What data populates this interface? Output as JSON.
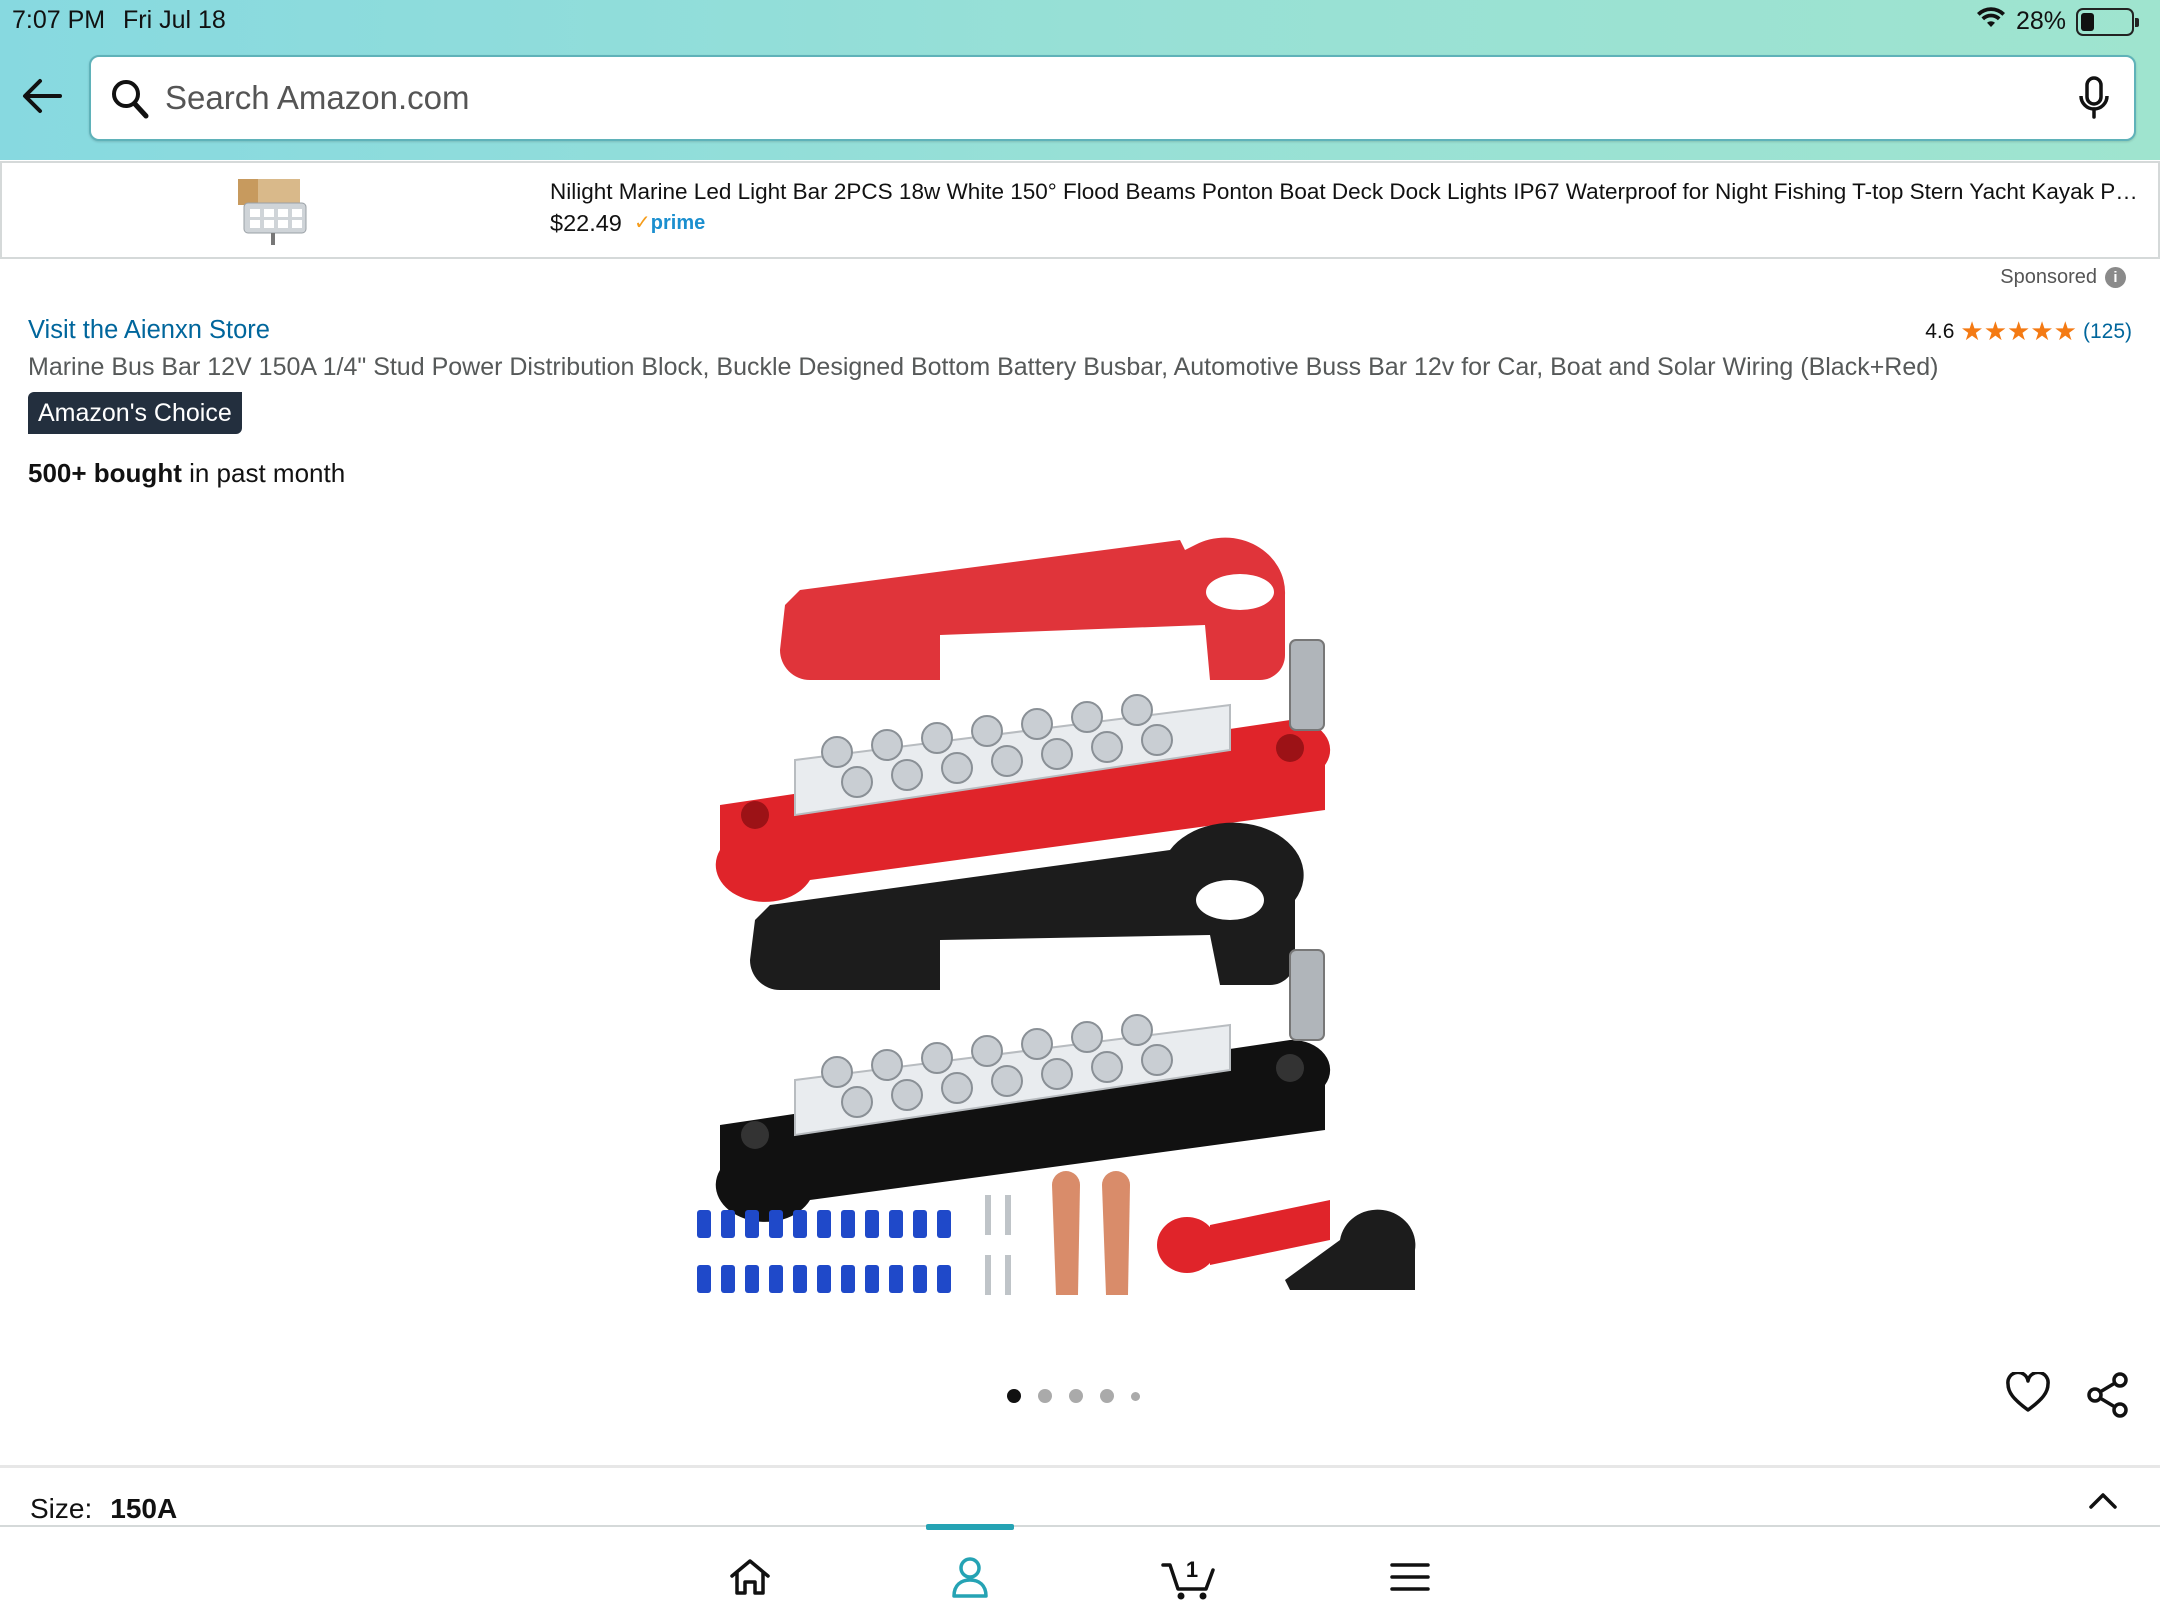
{
  "status_bar": {
    "time": "7:07 PM",
    "date": "Fri Jul 18",
    "battery": "28%",
    "battery_level": 0.28
  },
  "search": {
    "placeholder": "Search Amazon.com"
  },
  "sponsored_ad": {
    "title": "Nilight Marine Led Light Bar 2PCS 18w White 150° Flood Beams Ponton Boat Deck Dock Lights IP67 Waterproof for Night Fishing T-top Stern Yacht Kayak Pontoon Boat",
    "price": "$22.49",
    "prime": "prime"
  },
  "sponsored_label": "Sponsored",
  "product": {
    "store_link": "Visit the Aienxn Store",
    "rating_value": "4.6",
    "rating_stars": "★★★★★",
    "rating_count": "(125)",
    "title": "Marine Bus Bar 12V 150A 1/4\" Stud Power Distribution Block, Buckle Designed Bottom Battery Busbar, Automotive Buss Bar 12v for Car, Boat and Solar Wiring (Black+Red)",
    "badge": "Amazon's Choice",
    "bought_bold": "500+ bought",
    "bought_rest": " in past month"
  },
  "carousel": {
    "image_count": 5,
    "active_index": 0
  },
  "size": {
    "label": "Size:",
    "value": "150A"
  },
  "bottom_nav": {
    "cart_count": "1",
    "active": "account"
  },
  "colors": {
    "accent": "#25a3b4",
    "link": "#00669c",
    "star": "#f47a13",
    "badge_bg": "#232f3e"
  }
}
